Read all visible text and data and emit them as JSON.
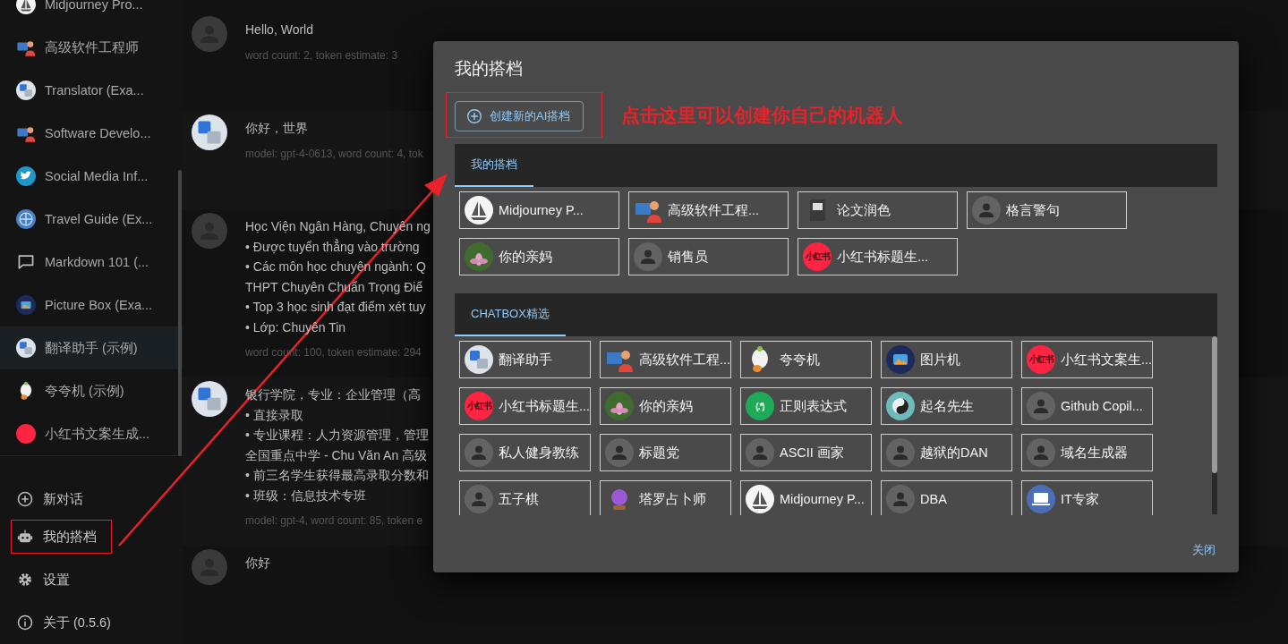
{
  "sidebar": {
    "sessions": [
      {
        "label": "Midjourney Pro...",
        "kind": "sailboat",
        "selected": false
      },
      {
        "label": "高级软件工程师",
        "kind": "coder",
        "selected": false
      },
      {
        "label": "Translator (Exa...",
        "kind": "translate",
        "selected": false
      },
      {
        "label": "Software Develo...",
        "kind": "coder",
        "selected": false
      },
      {
        "label": "Social Media Inf...",
        "kind": "bird",
        "selected": false
      },
      {
        "label": "Travel Guide (Ex...",
        "kind": "globe",
        "selected": false
      },
      {
        "label": "Markdown 101 (...",
        "kind": "chat",
        "selected": false
      },
      {
        "label": "Picture Box (Exa...",
        "kind": "picture",
        "selected": false
      },
      {
        "label": "翻译助手 (示例)",
        "kind": "translate",
        "selected": true
      },
      {
        "label": "夸夸机 (示例)",
        "kind": "mascot",
        "selected": false
      },
      {
        "label": "小红书文案生成...",
        "kind": "xhs",
        "selected": false
      }
    ],
    "actions": [
      {
        "label": "新对话",
        "kind": "plus",
        "annotated": false
      },
      {
        "label": "我的搭档",
        "kind": "robot",
        "annotated": true
      },
      {
        "label": "设置",
        "kind": "gear",
        "annotated": false
      },
      {
        "label": "关于 (0.5.6)",
        "kind": "info",
        "annotated": false
      }
    ]
  },
  "messages": [
    {
      "kind": "user",
      "lines": [
        "Hello, World"
      ],
      "meta": "word count: 2, token estimate: 3"
    },
    {
      "kind": "assistant",
      "lines": [
        "你好，世界"
      ],
      "meta": "model: gpt-4-0613, word count: 4, tok"
    },
    {
      "kind": "user",
      "lines": [
        "Học Viện Ngân Hàng, Chuyên ng",
        "• Được tuyển thẳng vào trường",
        "• Các môn học chuyên ngành: Q",
        "THPT Chuyên Chuẩn Trọng Điể",
        "• Top 3 học sinh đạt điểm xét tuy",
        "• Lớp: Chuyên Tin"
      ],
      "meta": "word count: 100, token estimate: 294"
    },
    {
      "kind": "assistant",
      "lines": [
        "银行学院，专业：企业管理（高",
        "• 直接录取",
        "• 专业课程：人力资源管理，管理",
        "全国重点中学 - Chu Văn An 高级",
        "• 前三名学生获得最高录取分数和",
        "• 班级：信息技术专班"
      ],
      "meta": "model: gpt-4, word count: 85, token e"
    },
    {
      "kind": "user",
      "lines": [
        "你好"
      ]
    }
  ],
  "dialog": {
    "title": "我的搭档",
    "create_button": {
      "label": "创建新的AI搭档",
      "annotated": true
    },
    "callout": "点击这里可以创建你自己的机器人",
    "sections": [
      {
        "tab": {
          "label": "我的搭档",
          "selected": true
        },
        "items": [
          {
            "label": "Midjourney P...",
            "kind": "sailboat"
          },
          {
            "label": "高级软件工程...",
            "kind": "coder"
          },
          {
            "label": "论文润色",
            "kind": "book"
          },
          {
            "label": "格言警句",
            "kind": "person"
          },
          {
            "label": "你的亲妈",
            "kind": "lotus"
          },
          {
            "label": "销售员",
            "kind": "person"
          },
          {
            "label": "小红书标题生...",
            "kind": "xhs",
            "icon_text": "小红书"
          }
        ]
      },
      {
        "tab": {
          "label": "CHATBOX精选",
          "selected": true
        },
        "items": [
          {
            "label": "翻译助手",
            "kind": "translate"
          },
          {
            "label": "高级软件工程...",
            "kind": "coder"
          },
          {
            "label": "夸夸机",
            "kind": "mascot"
          },
          {
            "label": "图片机",
            "kind": "picture"
          },
          {
            "label": "小红书文案生...",
            "kind": "xhs",
            "icon_text": "小红书"
          },
          {
            "label": "小红书标题生...",
            "kind": "xhs",
            "icon_text": "小红书"
          },
          {
            "label": "你的亲妈",
            "kind": "lotus"
          },
          {
            "label": "正则表达式",
            "kind": "regex",
            "icon_text": "(.*)"
          },
          {
            "label": "起名先生",
            "kind": "taiji"
          },
          {
            "label": "Github Copil...",
            "kind": "person"
          },
          {
            "label": "私人健身教练",
            "kind": "person"
          },
          {
            "label": "标题党",
            "kind": "person"
          },
          {
            "label": "ASCII 画家",
            "kind": "person"
          },
          {
            "label": "越狱的DAN",
            "kind": "person"
          },
          {
            "label": "域名生成器",
            "kind": "person"
          },
          {
            "label": "五子棋",
            "kind": "person"
          },
          {
            "label": "塔罗占卜师",
            "kind": "crystal"
          },
          {
            "label": "Midjourney P...",
            "kind": "sailboat"
          },
          {
            "label": "DBA",
            "kind": "person"
          },
          {
            "label": "IT专家",
            "kind": "laptop"
          }
        ]
      }
    ],
    "close_button": "关闭"
  }
}
